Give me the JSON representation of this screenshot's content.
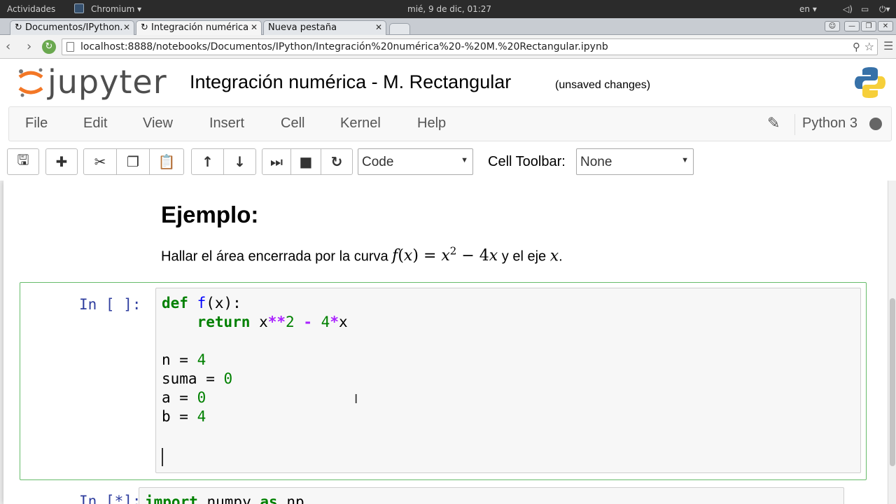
{
  "system_bar": {
    "activities": "Actividades",
    "app_name": "Chromium",
    "clock": "mié, 9 de dic, 01:27",
    "keyboard_layout": "en"
  },
  "browser": {
    "tabs": [
      {
        "label": "Documentos/IPython.",
        "active": false
      },
      {
        "label": "Integración numérica",
        "active": true
      },
      {
        "label": "Nueva pestaña",
        "active": false
      }
    ],
    "url": "localhost:8888/notebooks/Documentos/IPython/Integración%20numérica%20-%20M.%20Rectangular.ipynb"
  },
  "header": {
    "logo": "jupyter",
    "title": "Integración numérica - M. Rectangular",
    "status": "(unsaved changes)"
  },
  "menubar": {
    "items": [
      "File",
      "Edit",
      "View",
      "Insert",
      "Cell",
      "Kernel",
      "Help"
    ],
    "kernel_name": "Python 3"
  },
  "toolbar": {
    "cell_type": "Code",
    "cell_toolbar_label": "Cell Toolbar:",
    "cell_toolbar_value": "None"
  },
  "markdown_cell": {
    "heading": "Ejemplo:",
    "text_before": "Hallar el área encerrada por la curva",
    "text_after": "y el eje",
    "math_f": "f",
    "math_x": "x",
    "math_lparen": "(",
    "math_rparen": ")",
    "math_eq": "=",
    "math_exp": "2",
    "math_minus": "−",
    "math_four": "4",
    "math_period": "."
  },
  "code_cell_1": {
    "prompt": "In [ ]:",
    "lines": {
      "l1_def": "def",
      "l1_fn": "f",
      "l1_rest": "(x):",
      "l2_indent": "    ",
      "l2_return": "return",
      "l2_a": " x",
      "l2_pow": "**",
      "l2_two": "2",
      "l2_minus": "-",
      "l2_four": "4",
      "l2_mul": "*",
      "l2_x": "x",
      "l4_var": "n = ",
      "l4_val": "4",
      "l5_var": "suma = ",
      "l5_val": "0",
      "l6_var": "a = ",
      "l6_val": "0",
      "l7_var": "b = ",
      "l7_val": "4"
    }
  },
  "code_cell_2": {
    "prompt": "In [*]:",
    "kw_import": "import",
    "module": " numpy ",
    "kw_as": "as",
    "alias": " np"
  }
}
